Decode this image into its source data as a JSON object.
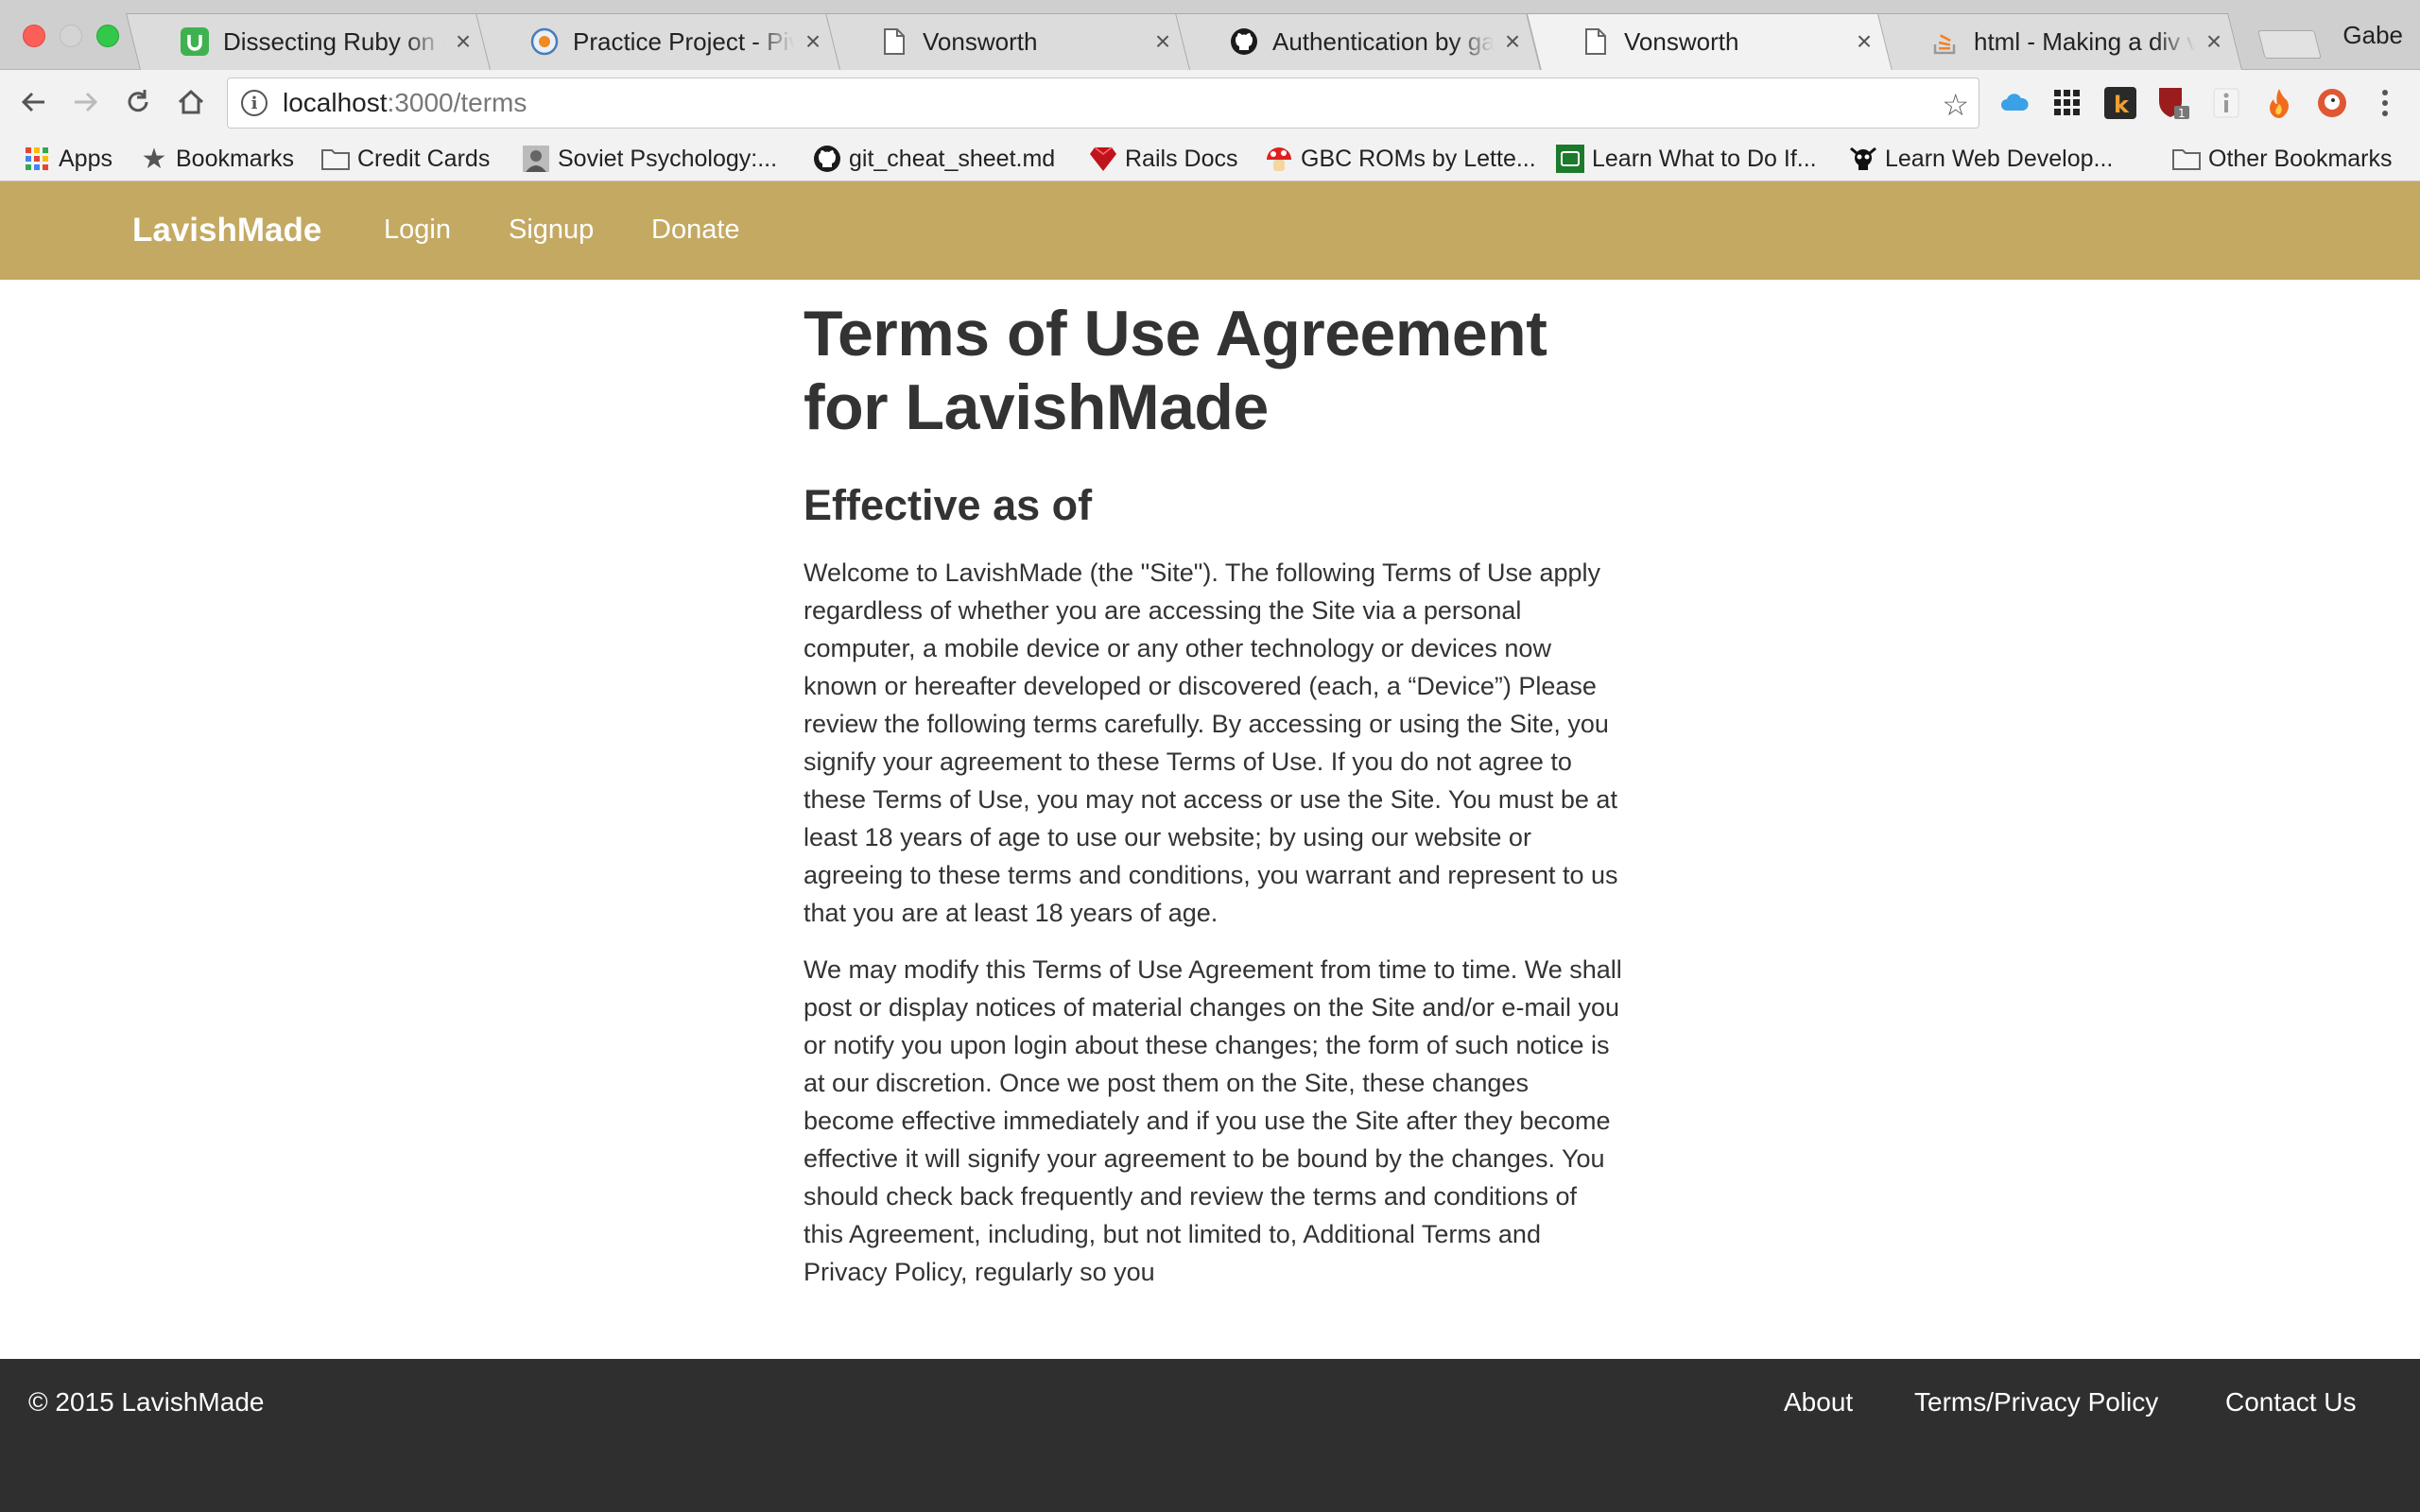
{
  "browser": {
    "tabs": [
      {
        "title": "Dissecting Ruby on Rails",
        "favicon": "udemy-u-icon",
        "active": false
      },
      {
        "title": "Practice Project - Pivotal",
        "favicon": "pivotal-icon",
        "active": false
      },
      {
        "title": "Vonsworth",
        "favicon": "page-icon",
        "active": false
      },
      {
        "title": "Authentication by gabe",
        "favicon": "github-icon",
        "active": false
      },
      {
        "title": "Vonsworth",
        "favicon": "page-icon",
        "active": true
      },
      {
        "title": "html - Making a div vertically",
        "favicon": "stackoverflow-icon",
        "active": false
      }
    ],
    "close_glyph": "×",
    "profile_name": "Gabe",
    "url_host": "localhost",
    "url_path": ":3000/terms",
    "extension_badge": "1",
    "bookmarks": [
      {
        "label": "Apps",
        "icon": "apps-grid-icon"
      },
      {
        "label": "Bookmarks",
        "icon": "star-icon"
      },
      {
        "label": "Credit Cards",
        "icon": "folder-icon"
      },
      {
        "label": "Soviet Psychology:...",
        "icon": "portrait-icon"
      },
      {
        "label": "git_cheat_sheet.md",
        "icon": "github-icon"
      },
      {
        "label": "Rails Docs",
        "icon": "ruby-icon"
      },
      {
        "label": "GBC ROMs by Lette...",
        "icon": "mushroom-icon"
      },
      {
        "label": "Learn What to Do If...",
        "icon": "green-tile-icon"
      },
      {
        "label": "Learn Web Develop...",
        "icon": "skull-icon"
      },
      {
        "label": "Other Bookmarks",
        "icon": "folder-icon"
      }
    ]
  },
  "site": {
    "brand": "LavishMade",
    "nav": [
      "Login",
      "Signup",
      "Donate"
    ],
    "colors": {
      "navbar": "#c4a962",
      "footer": "#2f2f2f",
      "text": "#333333"
    }
  },
  "terms": {
    "title": "Terms of Use Agreement for LavishMade",
    "effective": "Effective as of",
    "paragraphs": [
      "Welcome to LavishMade (the \"Site\"). The following Terms of Use apply regardless of whether you are accessing the Site via a personal computer, a mobile device or any other technology or devices now known or hereafter developed or discovered (each, a “Device”) Please review the following terms carefully. By accessing or using the Site, you signify your agreement to these Terms of Use. If you do not agree to these Terms of Use, you may not access or use the Site. You must be at least 18 years of age to use our website; by using our website or agreeing to these terms and conditions, you warrant and represent to us that you are at least 18 years of age.",
      "We may modify this Terms of Use Agreement from time to time. We shall post or display notices of material changes on the Site and/or e-mail you or notify you upon login about these changes; the form of such notice is at our discretion. Once we post them on the Site, these changes become effective immediately and if you use the Site after they become effective it will signify your agreement to be bound by the changes. You should check back frequently and review the terms and conditions of this Agreement, including, but not limited to, Additional Terms and Privacy Policy, regularly so you"
    ]
  },
  "footer": {
    "copyright": "© 2015 LavishMade",
    "links": [
      "About",
      "Terms/Privacy Policy",
      "Contact Us"
    ]
  }
}
